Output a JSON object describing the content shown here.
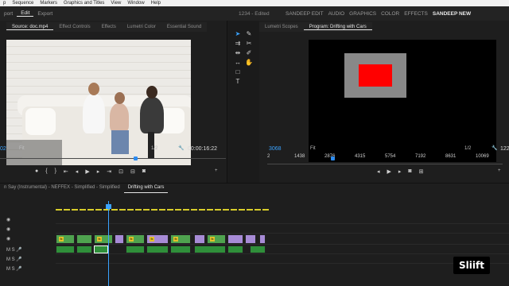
{
  "menu": [
    "p",
    "Sequence",
    "Markers",
    "Graphics and Titles",
    "View",
    "Window",
    "Help"
  ],
  "topbar": {
    "tabs": [
      "port",
      "Edit",
      "Export"
    ],
    "project_title": "1234 - Edited",
    "workspaces": [
      "SANDEEP EDIT",
      "AUDIO",
      "GRAPHICS",
      "COLOR",
      "EFFECTS",
      "SANDEEP NEW"
    ],
    "active_workspace": "SANDEEP NEW"
  },
  "source_panel": {
    "tabs": [
      "Source: doc.mp4",
      "Effect Controls",
      "Effects",
      "Lumetri Color",
      "Essential Sound"
    ],
    "timecode_in": "02",
    "fit": "Fit",
    "resolution": "1/2",
    "timecode_out": "00:00:16:22"
  },
  "program_panel": {
    "tabs": [
      "Lumetri Scopes",
      "Program: Drifting with Cars"
    ],
    "timecode_in": "3068",
    "fit": "Fit",
    "resolution": "1/2",
    "timecode_out": "122",
    "ruler_ticks": [
      "2",
      "1438",
      "2876",
      "4315",
      "5754",
      "7192",
      "8631",
      "10069"
    ]
  },
  "timeline": {
    "tabs": [
      "n Say (Instrumental) - NEFFEX - Simplified - Simplified",
      "Drifting with Cars"
    ],
    "tracks": [
      {
        "label": "V3"
      },
      {
        "label": "V2"
      },
      {
        "label": "V1"
      },
      {
        "label": "M  S"
      },
      {
        "label": "M  S"
      },
      {
        "label": "M  S"
      }
    ]
  },
  "logo_text": "Sliift",
  "colors": {
    "accent_blue": "#3aa3ff",
    "program_red": "#ff0000",
    "clip_green": "#4fa34f",
    "clip_purple": "#a78bd6"
  }
}
